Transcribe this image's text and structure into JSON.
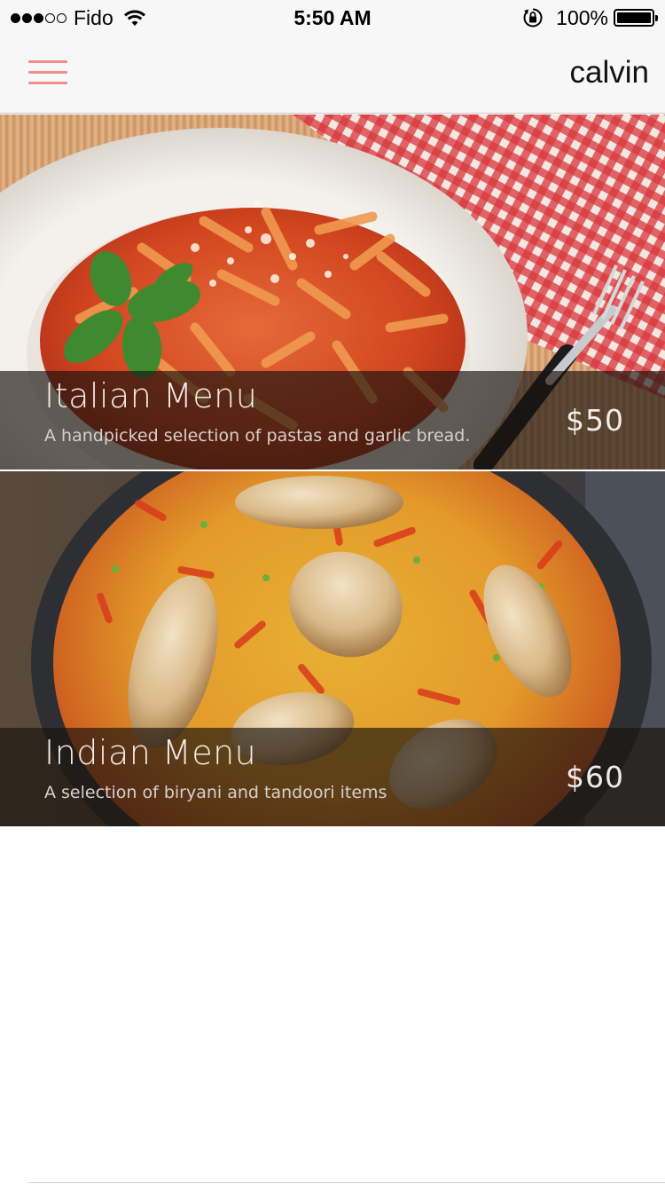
{
  "status_bar": {
    "carrier": "Fido",
    "time": "5:50 AM",
    "battery": "100%",
    "signal_bars": 3,
    "signal_max": 5,
    "icons": [
      "signal-dots",
      "wifi-icon",
      "rotation-lock-icon",
      "battery-icon"
    ]
  },
  "nav": {
    "menu_icon": "hamburger-menu-icon",
    "user_name": "calvin",
    "accent_color": "#f08e88"
  },
  "menus": [
    {
      "title": "Italian Menu",
      "description": "A handpicked selection of pastas and garlic bread.",
      "price": "$50",
      "image": "penne-pasta-with-basil-photo"
    },
    {
      "title": "Indian Menu",
      "description": "A selection of biryani and tandoori items",
      "price": "$60",
      "image": "biryani-with-chicken-legs-photo"
    }
  ]
}
